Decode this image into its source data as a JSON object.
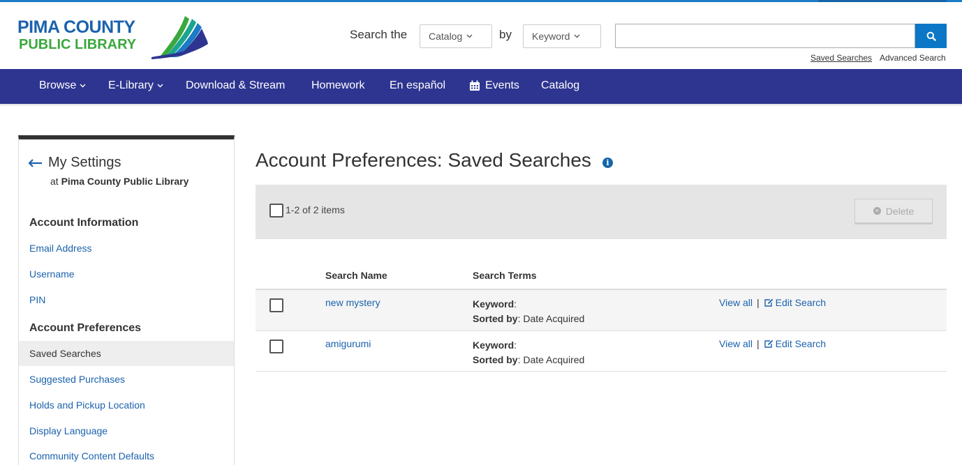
{
  "brand": {
    "line1": "PIMA COUNTY",
    "line2": "PUBLIC LIBRARY",
    "colors": {
      "blue": "#1b62ad",
      "green": "#3aa83d",
      "nav": "#2e3590",
      "accent": "#0c77c6"
    }
  },
  "search": {
    "label_search": "Search the",
    "scope": "Catalog",
    "label_by": "by",
    "field": "Keyword",
    "query": "",
    "button_icon": "search-icon",
    "saved_searches": "Saved Searches",
    "advanced_search": "Advanced Search"
  },
  "nav": {
    "items": [
      {
        "label": "Browse",
        "dropdown": true
      },
      {
        "label": "E-Library",
        "dropdown": true
      },
      {
        "label": "Download & Stream"
      },
      {
        "label": "Homework"
      },
      {
        "label": "En español"
      },
      {
        "label": "Events",
        "icon": "calendar-icon"
      },
      {
        "label": "Catalog"
      }
    ]
  },
  "sidebar": {
    "title": "My Settings",
    "at": "at",
    "library": "Pima County Public Library",
    "account_info_head": "Account Information",
    "account_info": [
      "Email Address",
      "Username",
      "PIN"
    ],
    "account_prefs_head": "Account Preferences",
    "account_prefs": [
      "Saved Searches",
      "Suggested Purchases",
      "Holds and Pickup Location",
      "Display Language",
      "Community Content Defaults"
    ]
  },
  "main": {
    "title": "Account Preferences: Saved Searches",
    "count": "1-2 of 2 items",
    "delete_label": "Delete",
    "columns": {
      "name": "Search Name",
      "terms": "Search Terms"
    },
    "rows": [
      {
        "name": "new mystery",
        "keyword_label": "Keyword",
        "keyword_value": "",
        "sorted_label": "Sorted by",
        "sorted_value": "Date Acquired",
        "view_all": "View all",
        "sep": "|",
        "edit": "Edit Search"
      },
      {
        "name": "amigurumi",
        "keyword_label": "Keyword",
        "keyword_value": "",
        "sorted_label": "Sorted by",
        "sorted_value": "Date Acquired",
        "view_all": "View all",
        "sep": "|",
        "edit": "Edit Search"
      }
    ]
  }
}
